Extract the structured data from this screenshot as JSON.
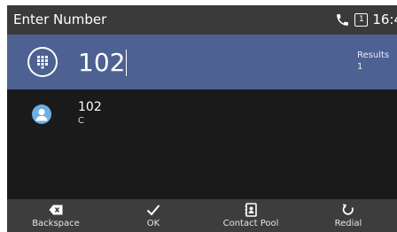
{
  "status_bar": {
    "title": "Enter Number",
    "line_badge": "1",
    "time": "16:4",
    "icons": [
      "phone-icon",
      "line-icon"
    ]
  },
  "input": {
    "value": "102",
    "results_label": "Results",
    "results_count": "1",
    "icon": "keypad-icon"
  },
  "results": [
    {
      "number": "102",
      "name": "C",
      "icon": "contact-avatar-icon"
    }
  ],
  "softkeys": [
    {
      "label": "Backspace",
      "icon": "backspace-icon"
    },
    {
      "label": "OK",
      "icon": "checkmark-icon"
    },
    {
      "label": "Contact Pool",
      "icon": "contact-book-icon"
    },
    {
      "label": "Redial",
      "icon": "redial-icon"
    }
  ],
  "colors": {
    "status_bar": "#3a3a3a",
    "input_row": "#4d6192",
    "background": "#1a1a1a",
    "softkey_bar": "#3d3d3d",
    "avatar": "#6ab0e6"
  }
}
